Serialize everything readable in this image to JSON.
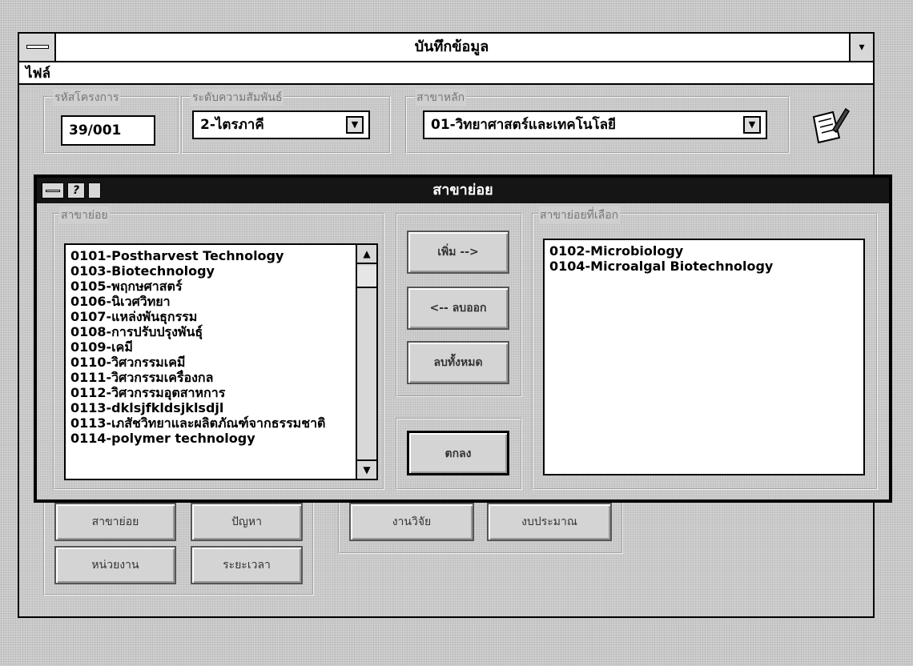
{
  "window": {
    "title": "บันทึกข้อมูล",
    "menu_file": "ไฟล์"
  },
  "fields": {
    "code_label": "รหัสโครงการ",
    "code_value": "39/001",
    "level_label": "ระดับความสัมพันธ์",
    "level_value": "2-ไตรภาคี",
    "main_branch_label": "สาขาหลัก",
    "main_branch_value": "01-วิทยาศาสตร์และเทคโนโลยี"
  },
  "main_buttons": {
    "subbranch": "สาขาย่อย",
    "problem": "ปัญหา",
    "research": "งานวิจัย",
    "budget": "งบประมาณ",
    "agency": "หน่วยงาน",
    "period": "ระยะเวลา"
  },
  "dialog": {
    "title": "สาขาย่อย",
    "available_label": "สาขาย่อย",
    "selected_label": "สาขาย่อยที่เลือก",
    "available_items": [
      "0101-Postharvest Technology",
      "0103-Biotechnology",
      "0105-พฤกษศาสตร์",
      "0106-นิเวศวิทยา",
      "0107-แหล่งพันธุกรรม",
      "0108-การปรับปรุงพันธุ์",
      "0109-เคมี",
      "0110-วิศวกรรมเคมี",
      "0111-วิศวกรรมเครื่องกล",
      "0112-วิศวกรรมอุตสาหการ",
      "0113-dklsjfkldsjklsdjl",
      "0113-เภสัชวิทยาและผลิตภัณฑ์จากธรรมชาติ",
      "0114-polymer technology"
    ],
    "selected_items": [
      "0102-Microbiology",
      "0104-Microalgal Biotechnology"
    ],
    "add_button": "เพิ่ม -->",
    "remove_button": "<-- ลบออก",
    "remove_all_button": "ลบทั้งหมด",
    "ok_button": "ตกลง"
  },
  "icons": [
    "system-menu-icon",
    "maximize-icon",
    "dropdown-arrow-icon",
    "edit-note-icon",
    "help-icon",
    "scroll-up-icon",
    "scroll-down-icon"
  ]
}
